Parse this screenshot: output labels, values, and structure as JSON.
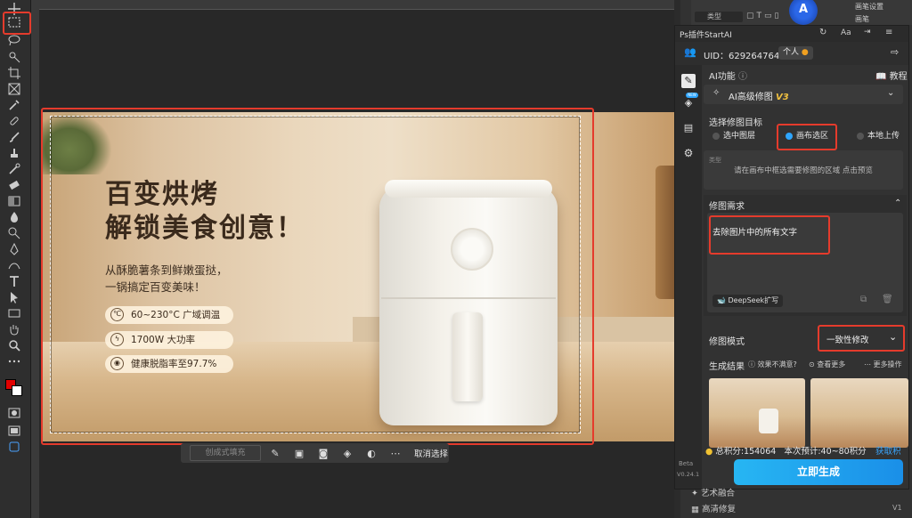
{
  "plugin": {
    "title": "Ps插件StartAI",
    "uid_label": "UID：629264764",
    "user_type": "个人",
    "ai_function_label": "AI功能",
    "tutorial_label": "教程",
    "ai_mode": "AI高级修图",
    "ai_mode_version": "V3",
    "target_label": "选择修图目标",
    "target_options": [
      "选中图层",
      "画布选区",
      "本地上传"
    ],
    "target_selected": "画布选区",
    "target_hint": "请在画布中框选需要修图的区域 点击预览",
    "type_placeholder": "类型",
    "requirement_label": "修图需求",
    "requirement_text": "去除图片中的所有文字",
    "deepseek_label": "DeepSeek扩写",
    "mode_label": "修图模式",
    "mode_value": "一致性修改",
    "results_label": "生成结果",
    "results_unsatisfied": "效果不满意?",
    "view_more": "查看更多",
    "more_actions": "更多操作",
    "points_text": "总积分:154064",
    "estimate_text": "本次预计:40~80积分",
    "get_points": "获取积分",
    "generate_button": "立即生成",
    "beta_label": "Beta",
    "version_label": "V0.24.1"
  },
  "ps_top": {
    "item1": "画笔设置",
    "item2": "画笔",
    "layer_type": "类型"
  },
  "ps_bottom": {
    "item1": "艺术融合",
    "item2": "高清修复",
    "item2_badge": "V1"
  },
  "ctxbar": {
    "generative_fill": "创成式填充",
    "deselect": "取消选择"
  },
  "banner": {
    "title_line1": "百变烘烤",
    "title_line2": "解锁美食创意！",
    "sub_line1": "从酥脆薯条到鲜嫩蛋挞，",
    "sub_line2": "一锅搞定百变美味！",
    "features": [
      "60~230°C 广域调温",
      "1700W 大功率",
      "健康脱脂率至97.7%"
    ]
  },
  "colors": {
    "accent": "#2ea6ff",
    "highlight": "#e53b2c",
    "points_gold": "#f1c232",
    "get_points": "#3aa6ff"
  }
}
